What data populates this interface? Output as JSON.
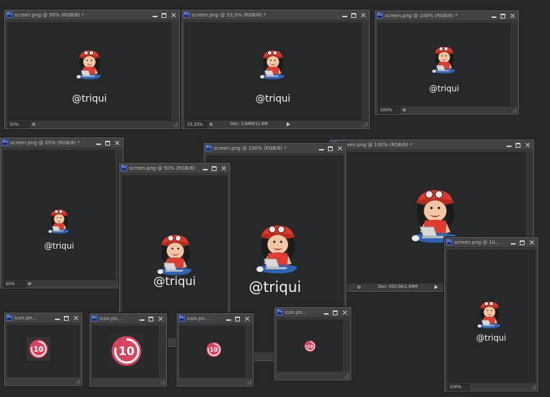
{
  "windows": [
    {
      "id": "w1",
      "title": "screen.png @ 50% (RGB/8) *",
      "zoom": "50%",
      "doc": ""
    },
    {
      "id": "w2",
      "title": "screen.png @ 33,3% (RGB/8) *",
      "zoom": "33,33%",
      "doc": "Doc: 2,64M/11,6M"
    },
    {
      "id": "w3",
      "title": "screen.png @ 100% (RGB/8) *",
      "zoom": "100%",
      "doc": ""
    },
    {
      "id": "w4",
      "title": "screen.png @ 25% (RGB/8) *",
      "zoom": "25%",
      "doc": ""
    },
    {
      "id": "w5",
      "title": "screen.png @ 50% (RGB/8) *",
      "zoom": "",
      "doc": ""
    },
    {
      "id": "w6",
      "title": "screen.png @ 100% (RGB/8) *",
      "zoom": "",
      "doc": ""
    },
    {
      "id": "w7",
      "title": "screen.png @ 100% (RGB/8) *",
      "zoom": "",
      "doc": "Doc: 450,0K/1,69M"
    },
    {
      "id": "w8",
      "title": "screen.png @ 10...",
      "zoom": "100%",
      "doc": ""
    },
    {
      "id": "i1",
      "title": "icon.pn...",
      "zoom": "",
      "doc": ""
    },
    {
      "id": "i2",
      "title": "icon.pn...",
      "zoom": "",
      "doc": ""
    },
    {
      "id": "i3",
      "title": "icon.pn...",
      "zoom": "",
      "doc": ""
    },
    {
      "id": "i4",
      "title": "icon.pn...",
      "zoom": "",
      "doc": ""
    }
  ],
  "artwork": {
    "handle": "@triqui",
    "icon_number": "10"
  },
  "icons": {
    "app": "photoshop-ps-icon",
    "minimize": "minimize-icon",
    "maximize": "maximize-icon",
    "close": "close-icon"
  },
  "colors": {
    "background": "#282828",
    "canvas": "#262829",
    "icon_pink": "#d8445f",
    "cap_red": "#d93a2b",
    "shirt": "#e03c2f",
    "jeans": "#2f63b5"
  }
}
